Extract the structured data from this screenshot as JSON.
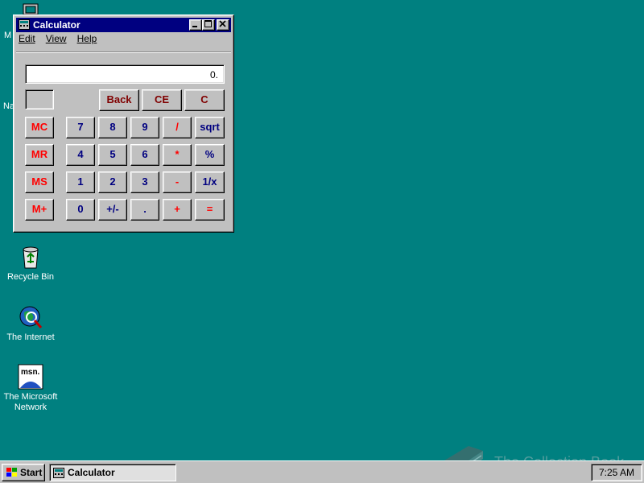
{
  "desktop": {
    "partial_labels": [
      "M",
      "Na"
    ],
    "icons": [
      {
        "name": "recycle-bin",
        "label": "Recycle Bin"
      },
      {
        "name": "the-internet",
        "label": "The Internet"
      },
      {
        "name": "msn",
        "label": "The Microsoft Network",
        "badge": "msn."
      }
    ]
  },
  "calculator": {
    "title": "Calculator",
    "menu": [
      "Edit",
      "View",
      "Help"
    ],
    "display_value": "0.",
    "buttons": {
      "back": "Back",
      "ce": "CE",
      "c": "C",
      "mc": "MC",
      "mr": "MR",
      "ms": "MS",
      "mplus": "M+",
      "n7": "7",
      "n8": "8",
      "n9": "9",
      "div": "/",
      "sqrt": "sqrt",
      "n4": "4",
      "n5": "5",
      "n6": "6",
      "mul": "*",
      "pct": "%",
      "n1": "1",
      "n2": "2",
      "n3": "3",
      "sub": "-",
      "inv": "1/x",
      "n0": "0",
      "sign": "+/-",
      "dot": ".",
      "add": "+",
      "eq": "="
    }
  },
  "taskbar": {
    "start_label": "Start",
    "tasks": [
      {
        "label": "Calculator"
      }
    ],
    "clock": "7:25 AM"
  },
  "watermark": "The Collection Book",
  "colors": {
    "desktop": "#008080",
    "titlebar": "#000080",
    "face": "#c0c0c0",
    "memory_keys": "#ff0000",
    "digit_keys": "#0000ff"
  }
}
